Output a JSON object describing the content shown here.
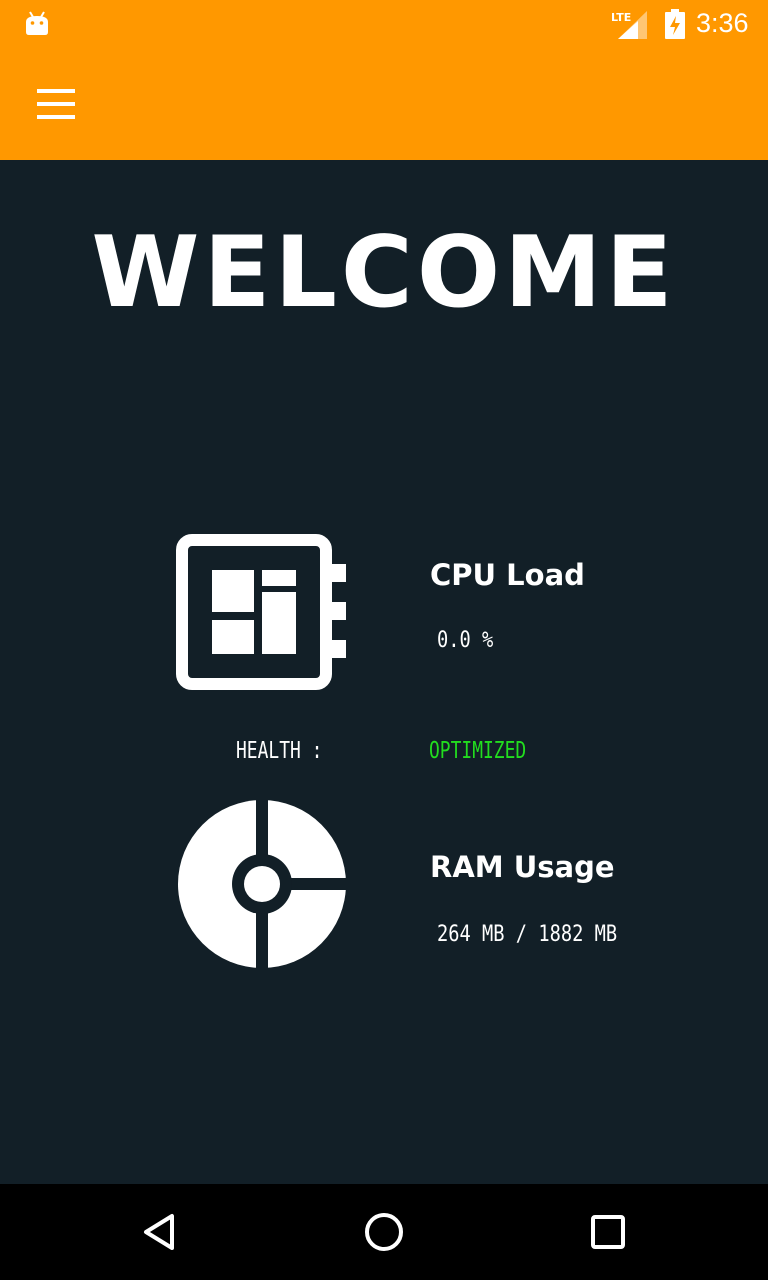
{
  "status_bar": {
    "time": "3:36",
    "network_label": "LTE",
    "icons": [
      "android-icon",
      "signal-icon",
      "battery-charging-icon"
    ]
  },
  "app_bar": {
    "menu_icon": "hamburger-menu-icon",
    "background_color": "#ff9800"
  },
  "main": {
    "title": "WELCOME",
    "background_color": "#121f27",
    "cpu": {
      "icon": "cpu-chip-icon",
      "title": "CPU Load",
      "value": "0.0 %"
    },
    "health": {
      "label": "HEALTH :",
      "value": "OPTIMIZED",
      "value_color": "#22dd1f"
    },
    "ram": {
      "icon": "ram-pie-icon",
      "title": "RAM Usage",
      "value": "264 MB / 1882 MB"
    }
  },
  "nav_bar": {
    "buttons": [
      "back-icon",
      "home-icon",
      "recents-icon"
    ]
  }
}
